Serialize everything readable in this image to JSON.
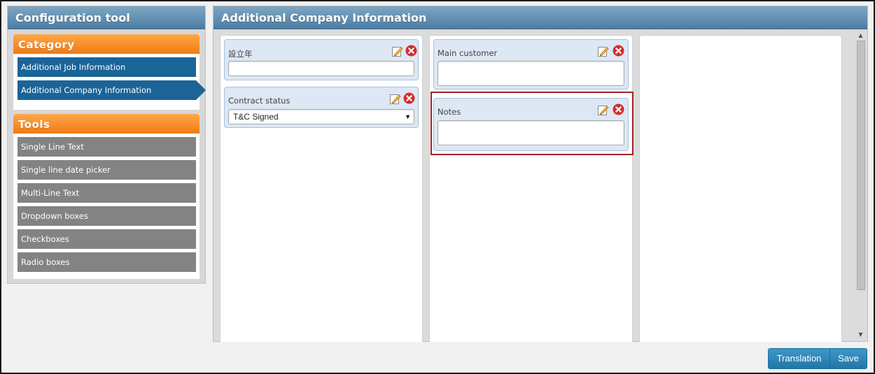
{
  "sidebar": {
    "title": "Configuration tool",
    "category": {
      "header": "Category",
      "items": [
        {
          "label": "Additional Job Information"
        },
        {
          "label": "Additional Company Information"
        }
      ]
    },
    "tools": {
      "header": "Tools",
      "items": [
        {
          "label": "Single Line Text"
        },
        {
          "label": "Single line date picker"
        },
        {
          "label": "Multi-Line Text"
        },
        {
          "label": "Dropdown boxes"
        },
        {
          "label": "Checkboxes"
        },
        {
          "label": "Radio boxes"
        }
      ]
    }
  },
  "main": {
    "title": "Additional Company Information",
    "columns": [
      {
        "fields": [
          {
            "label": "設立年",
            "value": ""
          },
          {
            "label": "Contract status",
            "value": "T&C Signed"
          }
        ]
      },
      {
        "fields": [
          {
            "label": "Main customer",
            "value": ""
          },
          {
            "label": "Notes",
            "value": ""
          }
        ]
      },
      {
        "fields": []
      }
    ]
  },
  "footer": {
    "translation_label": "Translation",
    "save_label": "Save"
  },
  "colors": {
    "header_blue": "#4d7da2",
    "category_orange": "#ef7a12",
    "active_category": "#1b6497",
    "tool_gray": "#838383",
    "highlight_red": "#a52025",
    "button_blue": "#2176a8"
  }
}
